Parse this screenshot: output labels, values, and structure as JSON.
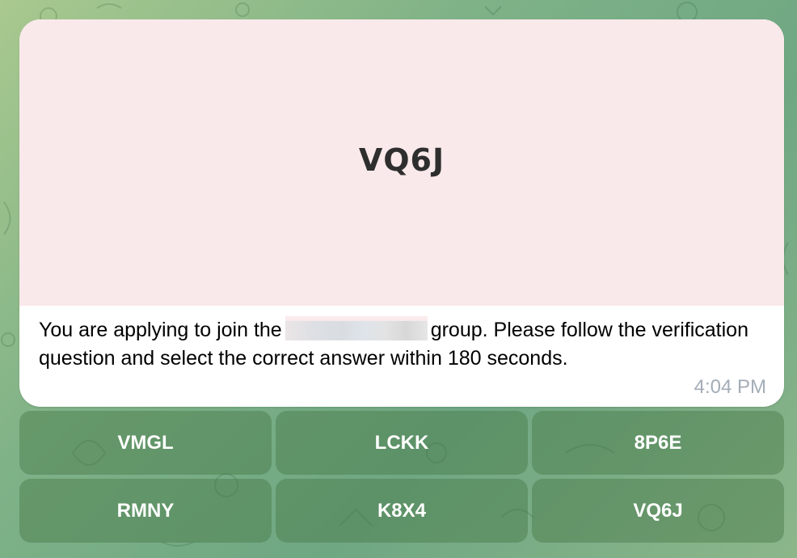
{
  "message": {
    "captcha_code": "VQ6J",
    "caption_before": "You are applying to join the",
    "caption_after": "group. Please follow the verification question and select the correct answer within 180 seconds.",
    "timestamp": "4:04 PM"
  },
  "keyboard": {
    "rows": [
      [
        "VMGL",
        "LCKK",
        "8P6E"
      ],
      [
        "RMNY",
        "K8X4",
        "VQ6J"
      ]
    ]
  },
  "colors": {
    "captcha_bg": "#f9e9ea",
    "bubble_bg": "#ffffff",
    "timestamp": "#a3adb6",
    "button_bg": "#5e8d5e"
  }
}
